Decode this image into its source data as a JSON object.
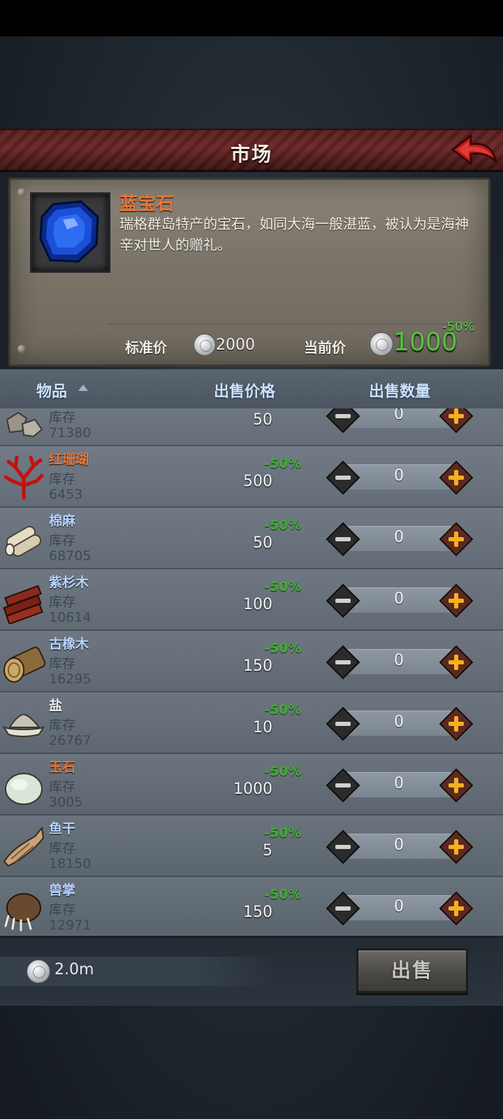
{
  "title": "市场",
  "detail": {
    "name": "蓝宝石",
    "description": "瑞格群岛特产的宝石，如同大海一般湛蓝，被认为是海神辛对世人的赠礼。",
    "standard_price_label": "标准价",
    "standard_price": "2000",
    "current_price_label": "当前价",
    "current_price": "1000",
    "current_discount": "-50%"
  },
  "list": {
    "headers": {
      "item": "物品",
      "price": "出售价格",
      "quantity": "出售数量"
    },
    "stock_label": "库存",
    "rows": [
      {
        "name": "",
        "stock": "71380",
        "price": "50",
        "discount": "",
        "quantity": "0",
        "icon": "stone-icon"
      },
      {
        "name": "红珊瑚",
        "stock": "6453",
        "price": "500",
        "discount": "-50%",
        "quantity": "0",
        "icon": "red-coral-icon",
        "name_color": "#e8763a"
      },
      {
        "name": "棉麻",
        "stock": "68705",
        "price": "50",
        "discount": "-50%",
        "quantity": "0",
        "icon": "cloth-roll-icon",
        "name_color": "#b8d4ff"
      },
      {
        "name": "紫杉木",
        "stock": "10614",
        "price": "100",
        "discount": "-50%",
        "quantity": "0",
        "icon": "yew-wood-icon",
        "name_color": "#b8d4ff"
      },
      {
        "name": "古橡木",
        "stock": "16295",
        "price": "150",
        "discount": "-50%",
        "quantity": "0",
        "icon": "oak-log-icon",
        "name_color": "#b8d4ff"
      },
      {
        "name": "盐",
        "stock": "26767",
        "price": "10",
        "discount": "-50%",
        "quantity": "0",
        "icon": "salt-icon",
        "name_color": "#f0f0f0"
      },
      {
        "name": "玉石",
        "stock": "3005",
        "price": "1000",
        "discount": "-50%",
        "quantity": "0",
        "icon": "jade-icon",
        "name_color": "#e8763a"
      },
      {
        "name": "鱼干",
        "stock": "18150",
        "price": "5",
        "discount": "-50%",
        "quantity": "0",
        "icon": "dried-fish-icon",
        "name_color": "#b8d4ff"
      },
      {
        "name": "兽掌",
        "stock": "12971",
        "price": "150",
        "discount": "-50%",
        "quantity": "0",
        "icon": "beast-paw-icon",
        "name_color": "#b8d4ff"
      }
    ]
  },
  "footer": {
    "money": "2.0m",
    "sell_label": "出售"
  },
  "colors": {
    "accent_orange": "#e8763a",
    "discount_green": "#54c43a",
    "banner_red": "#6b2626"
  }
}
